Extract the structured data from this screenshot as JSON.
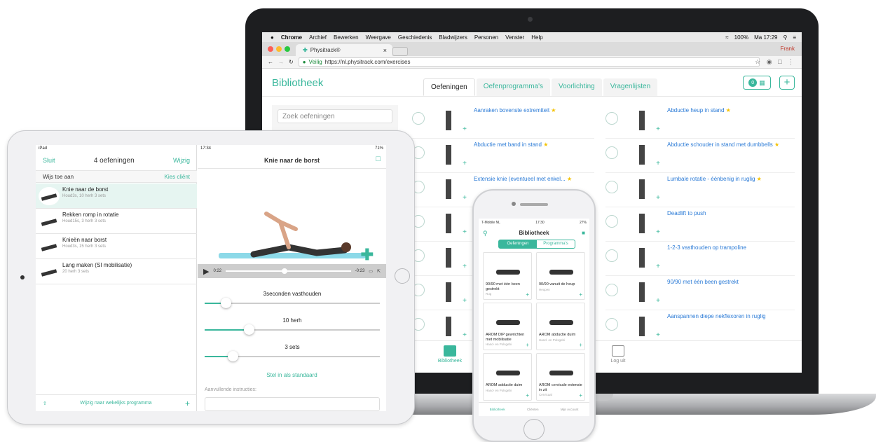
{
  "mac": {
    "menu": [
      "Chrome",
      "Archief",
      "Bewerken",
      "Weergave",
      "Geschiedenis",
      "Bladwijzers",
      "Personen",
      "Venster",
      "Help"
    ],
    "status": {
      "battery": "100%",
      "time": "Ma 17:29"
    }
  },
  "chrome": {
    "tab_title": "Physitrack®",
    "close": "×",
    "profile": "Frank",
    "secure": "Veilig",
    "url": "https://nl.physitrack.com/exercises"
  },
  "app": {
    "brand": "Bibliotheek",
    "tabs": [
      "Oefeningen",
      "Oefenprogramma's",
      "Voorlichting",
      "Vragenlijsten"
    ],
    "cart_count": "0",
    "plus": "+",
    "search_placeholder": "Zoek oefeningen",
    "col1": [
      {
        "name": "Aanraken bovenste extremiteit",
        "star": true
      },
      {
        "name": "Abductie met band in stand",
        "star": true
      },
      {
        "name": "Extensie knie (eventueel met enkel...",
        "star": true
      },
      {
        "name": "",
        "star": false
      },
      {
        "name": "",
        "star": false
      },
      {
        "name": "",
        "star": false
      },
      {
        "name": "",
        "star": false
      }
    ],
    "col2": [
      {
        "name": "Abductie heup in stand",
        "star": true
      },
      {
        "name": "Abductie schouder in stand met dumbbells",
        "star": true
      },
      {
        "name": "Lumbale rotatie - éénbenig in ruglig",
        "star": true
      },
      {
        "name": "Deadlift to push",
        "star": false
      },
      {
        "name": "1-2-3 vasthouden op trampoline",
        "star": false
      },
      {
        "name": "90/90 met één been gestrekt",
        "star": false
      },
      {
        "name": "Aanspannen diepe nekflexoren in ruglig",
        "star": false
      }
    ],
    "bottom_nav": {
      "library": "Bibliotheek",
      "logout": "Log uit"
    }
  },
  "ipad": {
    "status": {
      "device": "iPad",
      "time": "17:34",
      "battery": "71%"
    },
    "left": {
      "close": "Sluit",
      "title": "4 oefeningen",
      "edit": "Wijzig",
      "assign": "Wijs toe aan",
      "choose_client": "Kies cliënt",
      "items": [
        {
          "title": "Knie naar de borst",
          "sub": "Houd3s, 10 herh  3 sets"
        },
        {
          "title": "Rekken romp in rotatie",
          "sub": "Houd15s, 3 herh  3 sets"
        },
        {
          "title": "Knieën naar borst",
          "sub": "Houd3s, 15 herh  3 sets"
        },
        {
          "title": "Lang maken (SI mobilisatie)",
          "sub": "20 herh  3 sets"
        }
      ],
      "footer": "Wijzig naar wekelijks programma",
      "footer_plus": "+"
    },
    "right": {
      "title": "Knie naar de borst",
      "elapsed": "0:22",
      "remaining": "-0:23",
      "sliders": [
        {
          "label": "3seconden vasthouden",
          "level": 0.12
        },
        {
          "label": "10 herh",
          "level": 0.25
        },
        {
          "label": "3 sets",
          "level": 0.16
        }
      ],
      "default": "Stel in als standaard",
      "instructions": "Aanvullende instructies:"
    }
  },
  "iphone": {
    "status": {
      "carrier": "T-Mobile NL",
      "time": "17:30",
      "battery": "27%"
    },
    "title": "Bibliotheek",
    "seg": [
      "Oefeningen",
      "Programma's"
    ],
    "cards": [
      {
        "name": "90/90 met één been gestrekt",
        "sub": "Rug"
      },
      {
        "name": "90/90 vanuit de heup",
        "sub": "Heupen"
      },
      {
        "name": "AROM DIP gewrichten met mobilisatie",
        "sub": "Hand- en Polsgebi"
      },
      {
        "name": "AROM abductie duim",
        "sub": "Hand- en Polsgebi"
      },
      {
        "name": "AROM adductie duim",
        "sub": "Hand- en Polsgebi"
      },
      {
        "name": "AROM cervicale extensie in zit",
        "sub": "Cervicaal"
      }
    ],
    "nav": [
      "Bibliotheek",
      "Cliënten",
      "Mijn Account"
    ]
  },
  "colors": {
    "accent": "#3ab79c",
    "link": "#2a7ad6",
    "star": "#f4c200"
  }
}
